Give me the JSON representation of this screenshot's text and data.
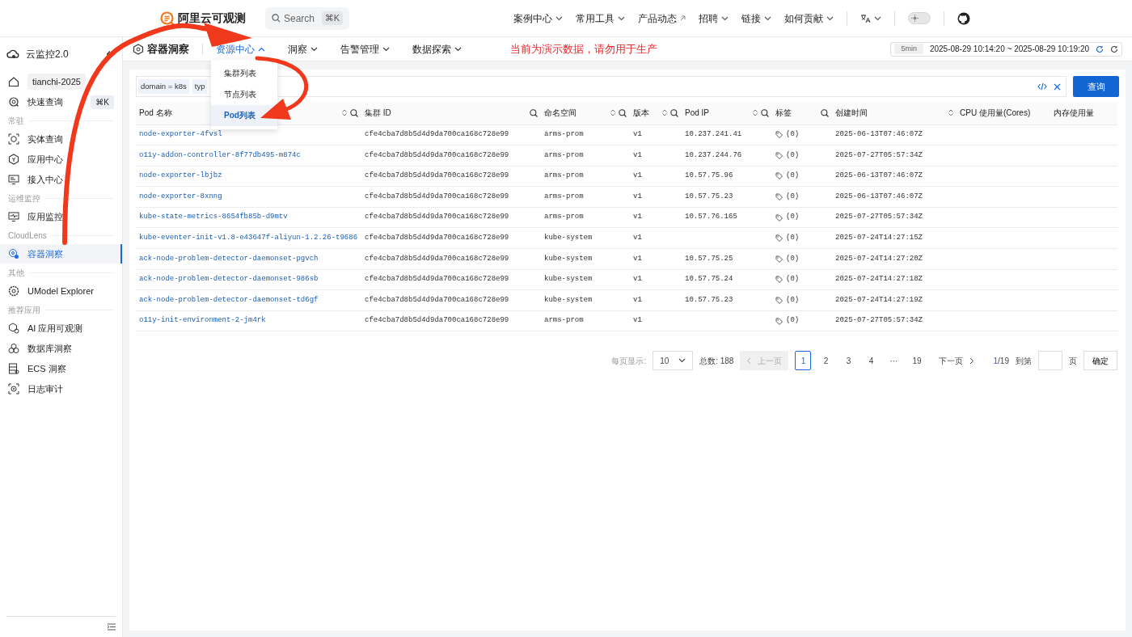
{
  "topbar": {
    "brand": "阿里云可观测",
    "search": {
      "placeholder": "Search",
      "shortcut": "⌘K"
    },
    "nav": [
      {
        "label": "案例中心",
        "kind": "dropdown"
      },
      {
        "label": "常用工具",
        "kind": "dropdown"
      },
      {
        "label": "产品动态",
        "kind": "external"
      },
      {
        "label": "招聘",
        "kind": "dropdown"
      },
      {
        "label": "链接",
        "kind": "dropdown"
      },
      {
        "label": "如何贡献",
        "kind": "dropdown"
      }
    ],
    "theme_dark": false
  },
  "sidebar": {
    "title": "云监控2.0",
    "items": [
      {
        "kind": "workspace",
        "label": "tianchi-2025",
        "selected": false
      },
      {
        "kind": "item",
        "label": "快速查询",
        "shortcut": "⌘K",
        "selected": false
      },
      {
        "kind": "section",
        "label": "常驻"
      },
      {
        "kind": "item",
        "label": "实体查询",
        "selected": false
      },
      {
        "kind": "item",
        "label": "应用中心",
        "selected": false
      },
      {
        "kind": "item",
        "label": "接入中心",
        "selected": false
      },
      {
        "kind": "section",
        "label": "运维监控"
      },
      {
        "kind": "item",
        "label": "应用监控",
        "selected": false
      },
      {
        "kind": "section",
        "label": "CloudLens"
      },
      {
        "kind": "item",
        "label": "容器洞察",
        "selected": true
      },
      {
        "kind": "section",
        "label": "其他"
      },
      {
        "kind": "item",
        "label": "UModel Explorer",
        "selected": false
      },
      {
        "kind": "section",
        "label": "推荐应用"
      },
      {
        "kind": "item",
        "label": "AI 应用可观测",
        "selected": false
      },
      {
        "kind": "item",
        "label": "数据库洞察",
        "selected": false
      },
      {
        "kind": "item",
        "label": "ECS 洞察",
        "selected": false
      },
      {
        "kind": "item",
        "label": "日志审计",
        "selected": false
      }
    ]
  },
  "header": {
    "title": "容器洞察",
    "menus": [
      {
        "label": "资源中心",
        "expanded": true,
        "items": [
          {
            "label": "集群列表",
            "selected": false
          },
          {
            "label": "节点列表",
            "selected": false
          },
          {
            "label": "Pod列表",
            "selected": true
          }
        ]
      },
      {
        "label": "洞察",
        "expanded": false
      },
      {
        "label": "告警管理",
        "expanded": false
      },
      {
        "label": "数据探索",
        "expanded": false
      }
    ],
    "notice": "当前为演示数据，请勿用于生产",
    "time_range": {
      "preset": "5min",
      "range": "2025-08-29 10:14:20 ~ 2025-08-29 10:19:20"
    }
  },
  "filter": {
    "chips": [
      "domain = k8s",
      "typ"
    ],
    "query_button": "查询"
  },
  "table": {
    "columns": [
      {
        "label": "Pod 名称",
        "sortable": true,
        "searchable": true
      },
      {
        "label": "集群 ID",
        "sortable": false,
        "searchable": true
      },
      {
        "label": "命名空间",
        "sortable": true,
        "searchable": true
      },
      {
        "label": "版本",
        "sortable": true,
        "searchable": true
      },
      {
        "label": "Pod IP",
        "sortable": true,
        "searchable": true
      },
      {
        "label": "标签",
        "sortable": false,
        "searchable": true
      },
      {
        "label": "创建时间",
        "sortable": true,
        "searchable": false
      },
      {
        "label": "CPU 使用量(Cores)",
        "sortable": false,
        "searchable": false
      },
      {
        "label": "内存使用量",
        "sortable": false,
        "searchable": false
      }
    ],
    "rows": [
      {
        "pod": "node-exporter-4fvsl",
        "cluster_id": "cfe4cba7d8b5d4d9da700ca168c728e99",
        "namespace": "arms-prom",
        "version": "v1",
        "pod_ip": "10.237.241.41",
        "labels": "(0)",
        "created": "2025-06-13T07:46:07Z"
      },
      {
        "pod": "o11y-addon-controller-8f77db495-m874c",
        "cluster_id": "cfe4cba7d8b5d4d9da700ca168c728e99",
        "namespace": "arms-prom",
        "version": "v1",
        "pod_ip": "10.237.244.76",
        "labels": "(0)",
        "created": "2025-07-27T05:57:34Z"
      },
      {
        "pod": "node-exporter-lbjbz",
        "cluster_id": "cfe4cba7d8b5d4d9da700ca168c728e99",
        "namespace": "arms-prom",
        "version": "v1",
        "pod_ip": "10.57.75.96",
        "labels": "(0)",
        "created": "2025-06-13T07:46:07Z"
      },
      {
        "pod": "node-exporter-8xnng",
        "cluster_id": "cfe4cba7d8b5d4d9da700ca168c728e99",
        "namespace": "arms-prom",
        "version": "v1",
        "pod_ip": "10.57.75.23",
        "labels": "(0)",
        "created": "2025-06-13T07:46:07Z"
      },
      {
        "pod": "kube-state-metrics-8654fb85b-d9mtv",
        "cluster_id": "cfe4cba7d8b5d4d9da700ca168c728e99",
        "namespace": "arms-prom",
        "version": "v1",
        "pod_ip": "10.57.76.165",
        "labels": "(0)",
        "created": "2025-07-27T05:57:34Z"
      },
      {
        "pod": "kube-eventer-init-v1.8-e43647f-aliyun-1.2.26-t9686",
        "cluster_id": "cfe4cba7d8b5d4d9da700ca168c728e99",
        "namespace": "kube-system",
        "version": "v1",
        "labels": "(0)",
        "created": "2025-07-24T14:27:15Z"
      },
      {
        "pod": "ack-node-problem-detector-daemonset-pgvch",
        "cluster_id": "cfe4cba7d8b5d4d9da700ca168c728e99",
        "namespace": "kube-system",
        "version": "v1",
        "pod_ip": "10.57.75.25",
        "labels": "(0)",
        "created": "2025-07-24T14:27:20Z"
      },
      {
        "pod": "ack-node-problem-detector-daemonset-986sb",
        "cluster_id": "cfe4cba7d8b5d4d9da700ca168c728e99",
        "namespace": "kube-system",
        "version": "v1",
        "pod_ip": "10.57.75.24",
        "labels": "(0)",
        "created": "2025-07-24T14:27:18Z"
      },
      {
        "pod": "ack-node-problem-detector-daemonset-td6gf",
        "cluster_id": "cfe4cba7d8b5d4d9da700ca168c728e99",
        "namespace": "kube-system",
        "version": "v1",
        "pod_ip": "10.57.75.23",
        "labels": "(0)",
        "created": "2025-07-24T14:27:19Z"
      },
      {
        "pod": "o11y-init-environment-2-jm4rk",
        "cluster_id": "cfe4cba7d8b5d4d9da700ca168c728e99",
        "namespace": "arms-prom",
        "version": "v1",
        "labels": "(0)",
        "created": "2025-07-27T05:57:34Z"
      }
    ]
  },
  "pagination": {
    "page_size_label": "每页显示:",
    "page_size": "10",
    "total": "总数: 188",
    "prev": {
      "label": "上一页",
      "disabled": true
    },
    "pages": [
      {
        "label": "1",
        "selected": true
      },
      {
        "label": "2",
        "selected": false
      },
      {
        "label": "3",
        "selected": false
      },
      {
        "label": "4",
        "selected": false
      },
      {
        "label": "···",
        "selected": false
      },
      {
        "label": "19",
        "selected": false
      }
    ],
    "next": {
      "label": "下一页",
      "disabled": false
    },
    "current": "1",
    "of": "/19",
    "goto_label": "到第",
    "goto_unit": "页",
    "confirm": "确定"
  }
}
